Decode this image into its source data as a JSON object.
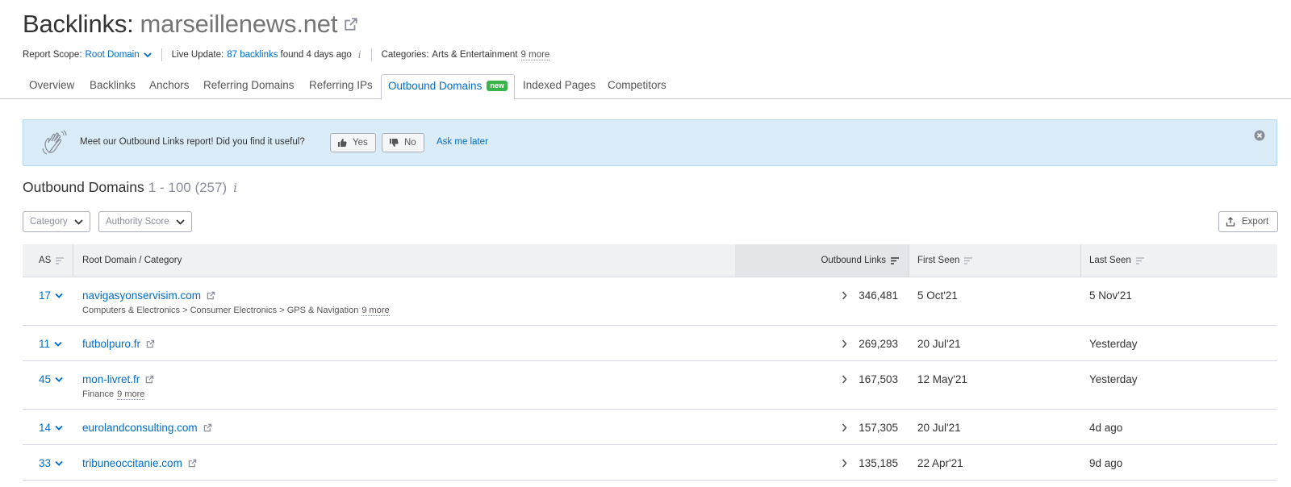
{
  "header": {
    "title_prefix": "Backlinks:",
    "domain": "marseillenews.net"
  },
  "meta": {
    "scope_label": "Report Scope:",
    "scope_value": "Root Domain",
    "live_label": "Live Update:",
    "live_count": "87 backlinks",
    "live_suffix": "found 4 days ago",
    "categories_label": "Categories:",
    "categories_value": "Arts & Entertainment",
    "categories_more": "9 more"
  },
  "tabs": [
    {
      "label": "Overview"
    },
    {
      "label": "Backlinks"
    },
    {
      "label": "Anchors"
    },
    {
      "label": "Referring Domains"
    },
    {
      "label": "Referring IPs"
    },
    {
      "label": "Outbound Domains",
      "badge": "new",
      "active": true
    },
    {
      "label": "Indexed Pages"
    },
    {
      "label": "Competitors"
    }
  ],
  "banner": {
    "message": "Meet our Outbound Links report! Did you find it useful?",
    "yes_label": "Yes",
    "no_label": "No",
    "later_label": "Ask me later"
  },
  "section": {
    "title": "Outbound Domains",
    "range": "1 - 100 (257)"
  },
  "filters": {
    "category_label": "Category",
    "authority_label": "Authority Score",
    "export_label": "Export"
  },
  "table": {
    "headers": {
      "as": "AS",
      "domain": "Root Domain / Category",
      "outbound": "Outbound Links",
      "first_seen": "First Seen",
      "last_seen": "Last Seen"
    },
    "rows": [
      {
        "as": "17",
        "domain": "navigasyonservisim.com",
        "category": "Computers & Electronics > Consumer Electronics > GPS & Navigation",
        "more": "9 more",
        "outbound": "346,481",
        "first_seen": "5 Oct'21",
        "last_seen": "5 Nov'21"
      },
      {
        "as": "11",
        "domain": "futbolpuro.fr",
        "category": "",
        "more": "",
        "outbound": "269,293",
        "first_seen": "20 Jul'21",
        "last_seen": "Yesterday"
      },
      {
        "as": "45",
        "domain": "mon-livret.fr",
        "category": "Finance",
        "more": "9 more",
        "outbound": "167,503",
        "first_seen": "12 May'21",
        "last_seen": "Yesterday"
      },
      {
        "as": "14",
        "domain": "eurolandconsulting.com",
        "category": "",
        "more": "",
        "outbound": "157,305",
        "first_seen": "20 Jul'21",
        "last_seen": "4d ago"
      },
      {
        "as": "33",
        "domain": "tribuneoccitanie.com",
        "category": "",
        "more": "",
        "outbound": "135,185",
        "first_seen": "22 Apr'21",
        "last_seen": "9d ago"
      }
    ]
  },
  "colors": {
    "link": "#006dca",
    "banner_bg": "#dbecf9",
    "badge_new": "#3ab44a",
    "header_bg": "#f0f1f3"
  }
}
